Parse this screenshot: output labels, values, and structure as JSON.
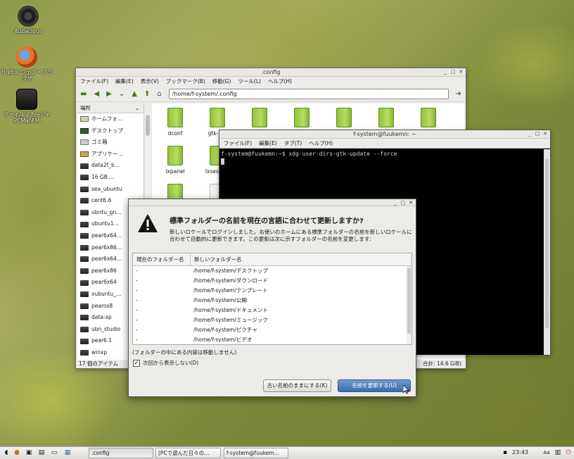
{
  "desktop": {
    "icons": [
      {
        "label": "Audacious"
      },
      {
        "label": "Firefox ウェブ・ブラウザ"
      },
      {
        "label": "ファイルマネージャ PCManFM"
      }
    ]
  },
  "filemanager": {
    "title": ".config",
    "menu": [
      "ファイル(F)",
      "編集(E)",
      "表示(V)",
      "ブックマーク(B)",
      "移動(G)",
      "ツール(L)",
      "ヘルプ(H)"
    ],
    "address": "/home/f-system/.config",
    "places_header": "場所",
    "places": [
      "ホームフォ…",
      "デスクトップ",
      "ゴミ箱",
      "アプリケー…",
      "data2f_b…",
      "16 GB …",
      "sea_ubuntu",
      "cent6.6",
      "ubntu_gn…",
      "ubuntu1…",
      "pear6x64…",
      "pear6x86…",
      "pear6x64…",
      "pear6x86",
      "pear6x64",
      "xubuntu_…",
      "pearos8",
      "data-xp",
      "ubn_studio",
      "pear6.1",
      "winxp"
    ],
    "files": [
      "dconf",
      "gtk-2.0",
      "",
      "",
      "",
      "",
      "",
      "lxpanel",
      "lxsession"
    ],
    "status_left": "17 個のアイテム",
    "status_right": "合計: 14.6 GiB)"
  },
  "terminal": {
    "title": "f-system@fuukemn: ~",
    "menu": [
      "ファイル(F)",
      "編集(E)",
      "タブ(T)",
      "ヘルプ(H)"
    ],
    "line1": "f-system@fuukemn:~$ xdg-user-dirs-gtk-update --force"
  },
  "dialog": {
    "heading": "標準フォルダーの名前を現在の言語に合わせて更新しますか?",
    "description": "新しいロケールでログインしました。お使いのホームにある標準フォルダーの名前を新しいロケールに合わせて自動的に更新できます。この更新は次に示すフォルダーの名前を変更します:",
    "col_current": "現在のフォルダー名",
    "col_new": "新しいフォルダー名",
    "rows": [
      {
        "current": "-",
        "new": "/home/f-system/デスクトップ"
      },
      {
        "current": "-",
        "new": "/home/f-system/ダウンロード"
      },
      {
        "current": "-",
        "new": "/home/f-system/テンプレート"
      },
      {
        "current": "-",
        "new": "/home/f-system/公開"
      },
      {
        "current": "-",
        "new": "/home/f-system/ドキュメント"
      },
      {
        "current": "-",
        "new": "/home/f-system/ミュージック"
      },
      {
        "current": "-",
        "new": "/home/f-system/ピクチャ"
      },
      {
        "current": "-",
        "new": "/home/f-system/ビデオ"
      }
    ],
    "note": "(フォルダーの中にある内容は移動しません)",
    "checkbox_label": "次回から表示しない(D)",
    "checkbox_checked": true,
    "btn_keep": "古い名前のままにする(K)",
    "btn_update": "名前を更新する(U)"
  },
  "taskbar": {
    "tasks": [
      ".config",
      "[PCで遊んだ日々の…",
      "f-system@fuukem…"
    ],
    "clock": "23:43"
  }
}
